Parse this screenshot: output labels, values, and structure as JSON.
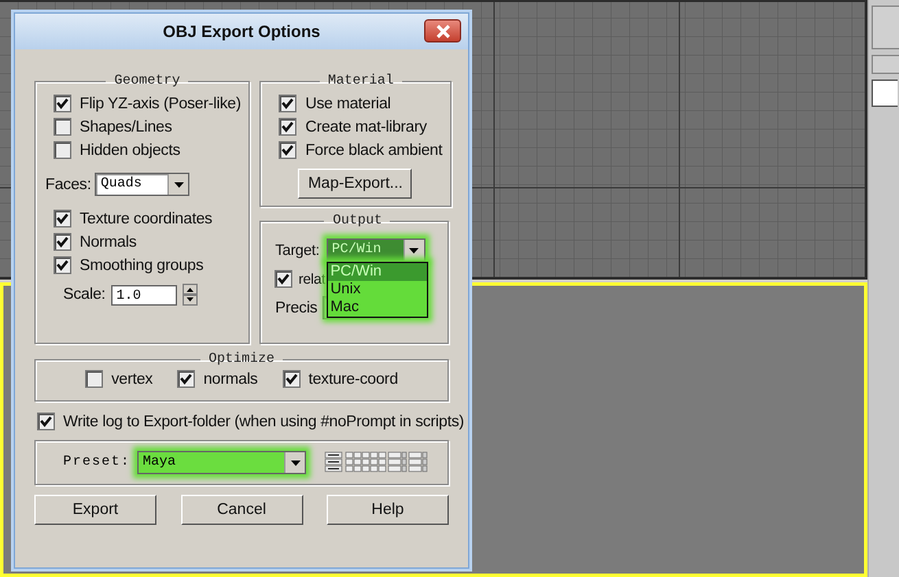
{
  "window": {
    "title": "OBJ Export Options"
  },
  "geometry": {
    "title": "Geometry",
    "options": [
      {
        "label": "Flip YZ-axis (Poser-like)",
        "checked": true
      },
      {
        "label": "Shapes/Lines",
        "checked": false
      },
      {
        "label": "Hidden objects",
        "checked": false
      }
    ],
    "faces": {
      "label": "Faces:",
      "value": "Quads"
    },
    "mapping": [
      {
        "label": "Texture coordinates",
        "checked": true
      },
      {
        "label": "Normals",
        "checked": true
      },
      {
        "label": "Smoothing groups",
        "checked": true
      }
    ],
    "scale": {
      "label": "Scale:",
      "value": "1.0"
    }
  },
  "material": {
    "title": "Material",
    "options": [
      {
        "label": "Use material",
        "checked": true
      },
      {
        "label": "Create mat-library",
        "checked": true
      },
      {
        "label": "Force black ambient",
        "checked": true
      }
    ],
    "button": "Map-Export..."
  },
  "output": {
    "title": "Output",
    "target": {
      "label": "Target:",
      "value": "PC/Win",
      "expanded": true,
      "highlighted": true,
      "options": [
        {
          "label": "PC/Win",
          "selected": true
        },
        {
          "label": "Unix",
          "selected": false
        },
        {
          "label": "Mac",
          "selected": false
        }
      ]
    },
    "relative": {
      "label": "relat",
      "checked": true
    },
    "precision": {
      "label": "Precis"
    }
  },
  "optimize": {
    "title": "Optimize",
    "options": [
      {
        "label": "vertex",
        "checked": false
      },
      {
        "label": "normals",
        "checked": true
      },
      {
        "label": "texture-coord",
        "checked": true
      }
    ]
  },
  "write_log": {
    "label": "Write log to Export-folder (when using #noPrompt in scripts)",
    "checked": true
  },
  "preset": {
    "label": "Preset:",
    "value": "Maya",
    "highlighted": true
  },
  "buttons": [
    "Export",
    "Cancel",
    "Help"
  ]
}
